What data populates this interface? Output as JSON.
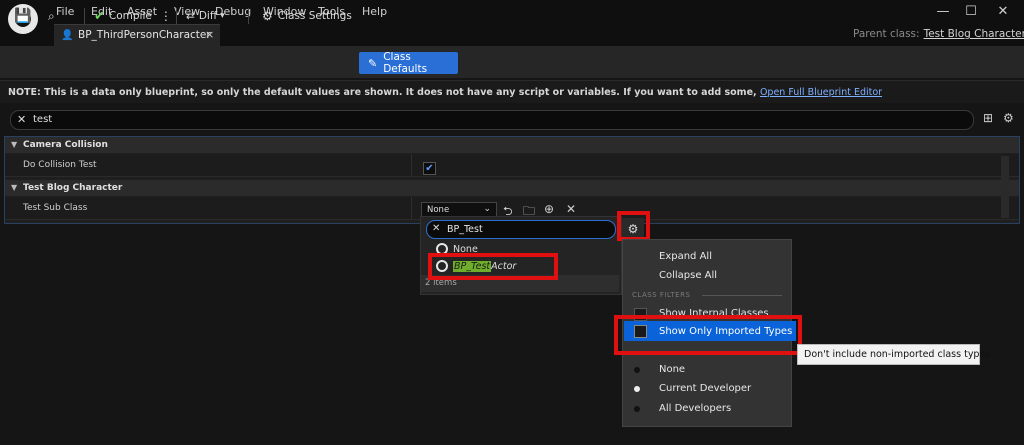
{
  "menu": [
    "File",
    "Edit",
    "Asset",
    "View",
    "Debug",
    "Window",
    "Tools",
    "Help"
  ],
  "tab": {
    "title": "BP_ThirdPersonCharacter",
    "close": "×"
  },
  "window_controls": {
    "minimize": "—",
    "maximize": "☐",
    "close": "✕"
  },
  "parent_class": {
    "label": "Parent class:",
    "value": "Test Blog Character"
  },
  "toolbar": {
    "compile": "Compile",
    "diff": "Diff",
    "class_settings": "Class Settings",
    "class_defaults": "Class Defaults"
  },
  "note": {
    "text": "NOTE: This is a data only blueprint, so only the default values are shown.  It does not have any script or variables.  If you want to add some,",
    "link": "Open Full Blueprint Editor"
  },
  "search": {
    "value": "test"
  },
  "categories": [
    {
      "name": "Camera Collision",
      "rows": [
        {
          "label": "Do Collision Test",
          "checked": true
        }
      ]
    },
    {
      "name": "Test Blog Character",
      "rows": [
        {
          "label": "Test Sub Class",
          "value": "None"
        }
      ]
    }
  ],
  "picker": {
    "search_value": "BP_Test",
    "items": [
      {
        "label": "None"
      },
      {
        "label_match": "BP_Test",
        "label_rest": "Actor"
      }
    ],
    "count": "2 items"
  },
  "options_menu": {
    "expand_all": "Expand All",
    "collapse_all": "Collapse All",
    "section": "CLASS FILTERS",
    "show_internal": "Show Internal Classes",
    "show_imported": "Show Only Imported Types",
    "developer": [
      "None",
      "Current Developer",
      "All Developers"
    ]
  },
  "tooltip": "Don't include non-imported class types.",
  "colors": {
    "accent": "#2a6fd6",
    "highlight": "#e01010"
  }
}
